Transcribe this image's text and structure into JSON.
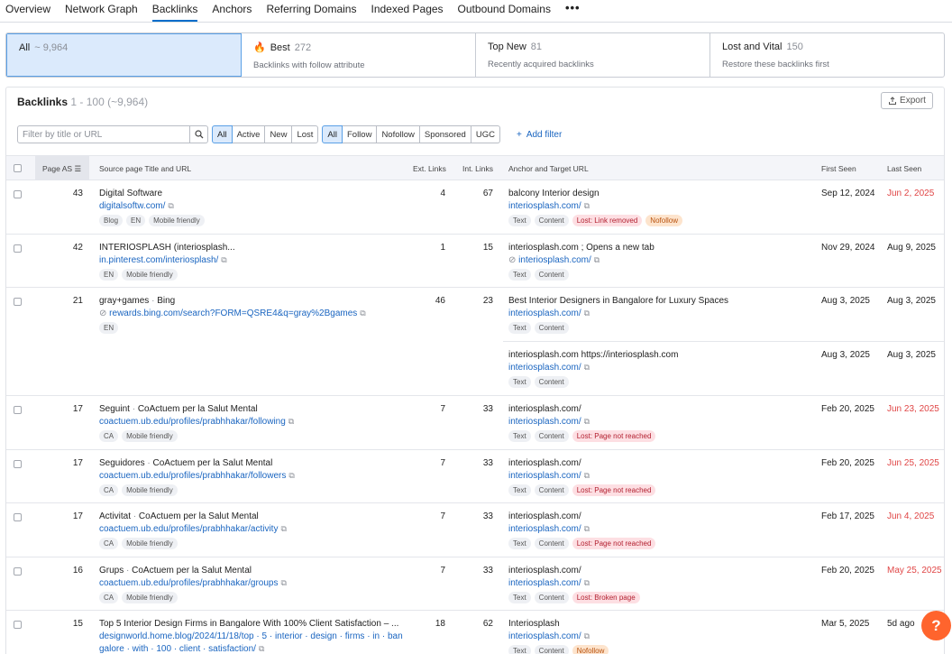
{
  "tabs": [
    "Overview",
    "Network Graph",
    "Backlinks",
    "Anchors",
    "Referring Domains",
    "Indexed Pages",
    "Outbound Domains",
    "•••"
  ],
  "cards": [
    {
      "title": "All",
      "count": "~ 9,964",
      "sub": ""
    },
    {
      "title": "Best",
      "count": "272",
      "sub": "Backlinks with follow attribute"
    },
    {
      "title": "Top New",
      "count": "81",
      "sub": "Recently acquired backlinks"
    },
    {
      "title": "Lost and Vital",
      "count": "150",
      "sub": "Restore these backlinks first"
    }
  ],
  "panel": {
    "title": "Backlinks",
    "range": "1 - 100 (~9,964)",
    "export": "Export"
  },
  "filters": {
    "search_placeholder": "Filter by title or URL",
    "status": [
      "All",
      "Active",
      "New",
      "Lost"
    ],
    "type": [
      "All",
      "Follow",
      "Nofollow",
      "Sponsored",
      "UGC"
    ],
    "add_filter": "Add filter"
  },
  "columns": {
    "page_as": "Page AS",
    "source": "Source page Title and URL",
    "ext": "Ext. Links",
    "int": "Int. Links",
    "anchor": "Anchor and Target URL",
    "first": "First Seen",
    "last": "Last Seen"
  },
  "rows": [
    {
      "as": "43",
      "title": "Digital Software",
      "url": "digitalsoftw.com/",
      "tags": [
        "Blog",
        "EN",
        "Mobile friendly"
      ],
      "ext": "4",
      "int": "67",
      "anchor": "balcony Interior design",
      "target": "interiosplash.com/",
      "atags": [
        "Text",
        "Content",
        "Lost: Link removed",
        "Nofollow"
      ],
      "first": "Sep 12, 2024",
      "last": "Jun 2, 2025"
    },
    {
      "as": "42",
      "title": "INTERIOSPLASH (interiosplash...",
      "url": "in.pinterest.com/interiosplash/",
      "tags": [
        "EN",
        "Mobile friendly"
      ],
      "ext": "1",
      "int": "15",
      "anchor": "interiosplash.com ; Opens a new tab",
      "target": "interiosplash.com/",
      "atags": [
        "Text",
        "Content"
      ],
      "first": "Nov 29, 2024",
      "last": "Aug 9, 2025"
    },
    {
      "as": "21",
      "title": "gray+games",
      "title2": "Bing",
      "url": "rewards.bing.com/search?FORM=QSRE4&q=gray%2Bgames",
      "tags": [
        "EN"
      ],
      "ext": "46",
      "int": "23",
      "anchor": "Best Interior Designers in Bangalore for Luxury Spaces",
      "target": "interiosplash.com/",
      "atags": [
        "Text",
        "Content"
      ],
      "first": "Aug 3, 2025",
      "last": "Aug 3, 2025",
      "anchor2": "interiosplash.com https://interiosplash.com",
      "target2": "interiosplash.com/",
      "atags2": [
        "Text",
        "Content"
      ],
      "first2": "Aug 3, 2025",
      "last2": "Aug 3, 2025"
    },
    {
      "as": "17",
      "title": "Seguint",
      "title2": "CoActuem per la Salut Mental",
      "url": "coactuem.ub.edu/profiles/prabhhakar/following",
      "tags": [
        "CA",
        "Mobile friendly"
      ],
      "ext": "7",
      "int": "33",
      "anchor": "interiosplash.com/",
      "target": "interiosplash.com/",
      "atags": [
        "Text",
        "Content",
        "Lost: Page not reached"
      ],
      "first": "Feb 20, 2025",
      "last": "Jun 23, 2025"
    },
    {
      "as": "17",
      "title": "Seguidores",
      "title2": "CoActuem per la Salut Mental",
      "url": "coactuem.ub.edu/profiles/prabhhakar/followers",
      "tags": [
        "CA",
        "Mobile friendly"
      ],
      "ext": "7",
      "int": "33",
      "anchor": "interiosplash.com/",
      "target": "interiosplash.com/",
      "atags": [
        "Text",
        "Content",
        "Lost: Page not reached"
      ],
      "first": "Feb 20, 2025",
      "last": "Jun 25, 2025"
    },
    {
      "as": "17",
      "title": "Activitat",
      "title2": "CoActuem per la Salut Mental",
      "url": "coactuem.ub.edu/profiles/prabhhakar/activity",
      "tags": [
        "CA",
        "Mobile friendly"
      ],
      "ext": "7",
      "int": "33",
      "anchor": "interiosplash.com/",
      "target": "interiosplash.com/",
      "atags": [
        "Text",
        "Content",
        "Lost: Page not reached"
      ],
      "first": "Feb 17, 2025",
      "last": "Jun 4, 2025"
    },
    {
      "as": "16",
      "title": "Grups",
      "title2": "CoActuem per la Salut Mental",
      "url": "coactuem.ub.edu/profiles/prabhhakar/groups",
      "tags": [
        "CA",
        "Mobile friendly"
      ],
      "ext": "7",
      "int": "33",
      "anchor": "interiosplash.com/",
      "target": "interiosplash.com/",
      "atags": [
        "Text",
        "Content",
        "Lost: Broken page"
      ],
      "first": "Feb 20, 2025",
      "last": "May 25, 2025"
    },
    {
      "as": "15",
      "title": "Top 5 Interior Design Firms in Bangalore With 100% Client Satisfaction – ...",
      "url": "designworld.home.blog/2024/11/18/top · 5 · interior · design · firms · in · ban",
      "url2": "galore · with · 100 · client · satisfaction/",
      "tags": [],
      "ext": "18",
      "int": "62",
      "anchor": "Interiosplash",
      "target": "interiosplash.com/",
      "atags": [
        "Text",
        "Content",
        "Nofollow"
      ],
      "first": "Mar 5, 2025",
      "last": "5d ago"
    }
  ],
  "help": "?"
}
